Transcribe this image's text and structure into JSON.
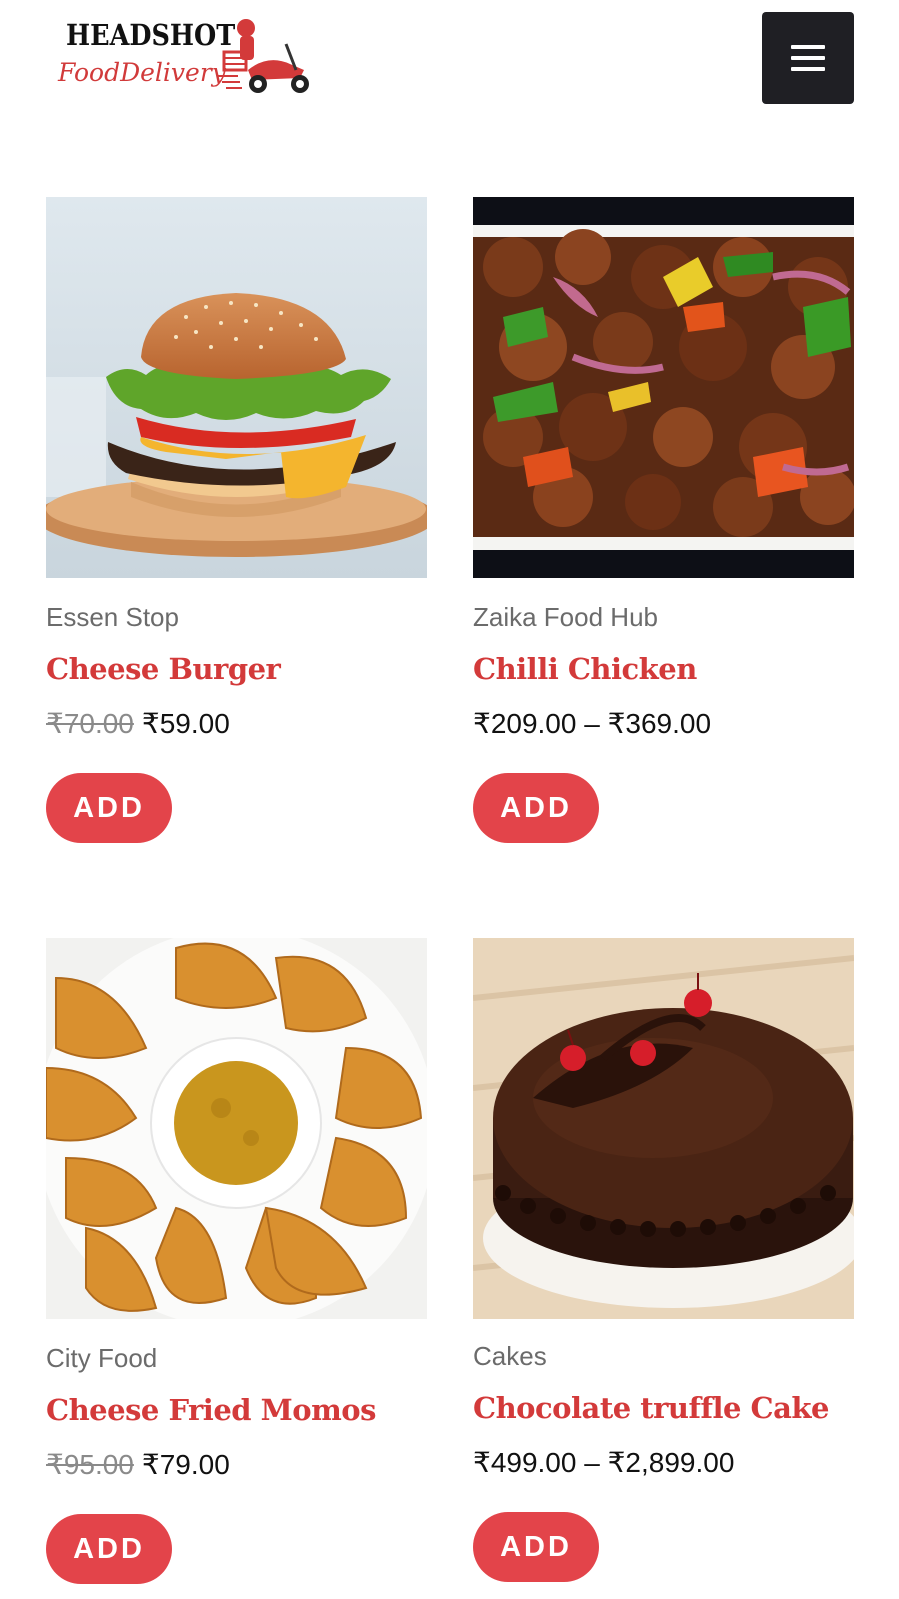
{
  "brand": {
    "title": "HEADSHOT",
    "subtitle": "FoodDelivery",
    "accent": "#d33a3a"
  },
  "header": {
    "menu_icon": "hamburger-menu-icon"
  },
  "colors": {
    "add_button": "#e3444a",
    "title_red": "#d33a3a",
    "menu_bg": "#1f1f24"
  },
  "products": [
    {
      "category": "Essen Stop",
      "title": "Cheese Burger",
      "old_price": "₹70.00",
      "price": "₹59.00",
      "add_label": "ADD"
    },
    {
      "category": "Zaika Food Hub",
      "title": "Chilli Chicken",
      "old_price": "",
      "price": "₹209.00 – ₹369.00",
      "add_label": "ADD"
    },
    {
      "category": "City Food",
      "title": "Cheese Fried Momos",
      "old_price": "₹95.00",
      "price": "₹79.00",
      "add_label": "ADD"
    },
    {
      "category": "Cakes",
      "title": "Chocolate truffle Cake",
      "old_price": "",
      "price": "₹499.00 – ₹2,899.00",
      "add_label": "ADD"
    }
  ]
}
